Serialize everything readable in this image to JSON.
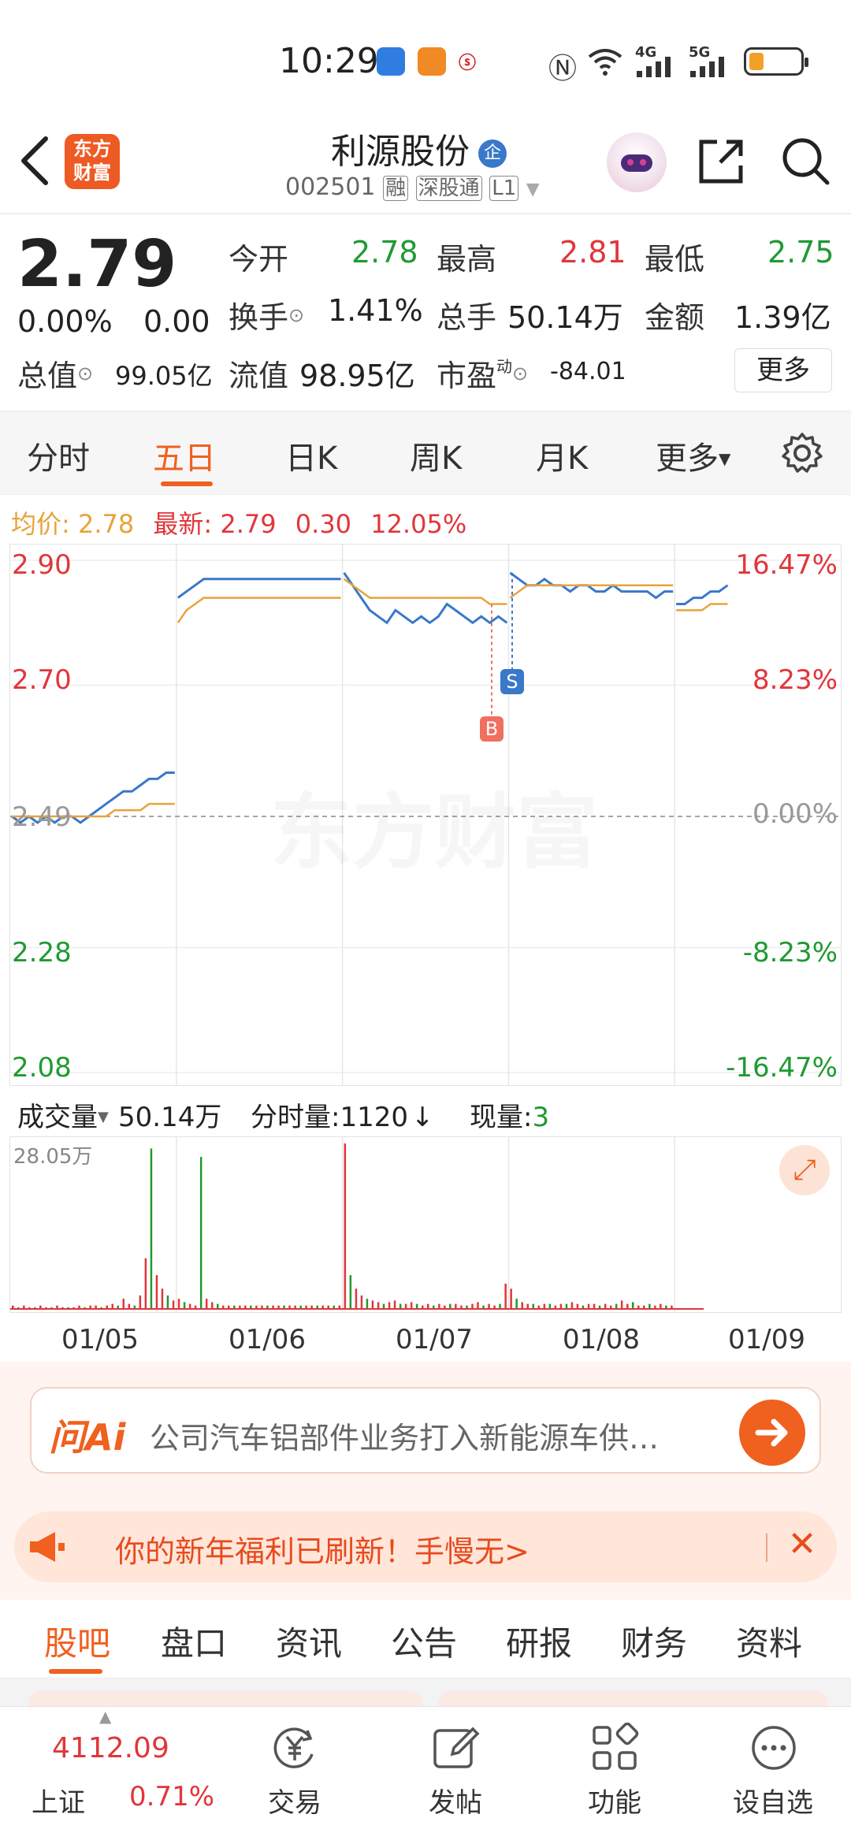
{
  "status_bar": {
    "time": "10:29",
    "network_4g": "4G",
    "network_5g": "5G"
  },
  "header": {
    "logo_text_1": "东方",
    "logo_text_2": "财富",
    "stock_name": "利源股份",
    "badge": "企",
    "code": "002501",
    "tags": [
      "融",
      "深股通",
      "L1"
    ]
  },
  "quote": {
    "price": "2.79",
    "change_pct": "0.00%",
    "change": "0.00",
    "open_label": "今开",
    "open": "2.78",
    "high_label": "最高",
    "high": "2.81",
    "low_label": "最低",
    "low": "2.75",
    "turnover_label": "换手",
    "turnover": "1.41%",
    "volume_label": "总手",
    "volume": "50.14万",
    "amount_label": "金额",
    "amount": "1.39亿",
    "mktcap_label": "总值",
    "mktcap": "99.05亿",
    "float_label": "流值",
    "float": "98.95亿",
    "pe_label": "市盈",
    "pe_sup": "动",
    "pe": "-84.01",
    "more": "更多"
  },
  "tabs": {
    "items": [
      "分时",
      "五日",
      "日K",
      "周K",
      "月K",
      "更多"
    ],
    "active": "五日"
  },
  "avg_line": {
    "avg_label": "均价:",
    "avg": "2.78",
    "last_label": "最新:",
    "last": "2.79",
    "chg": "0.30",
    "pct": "12.05%"
  },
  "chart_data": {
    "type": "line",
    "y_left_ticks": [
      "2.90",
      "2.70",
      "2.49",
      "2.28",
      "2.08"
    ],
    "y_right_ticks": [
      "16.47%",
      "8.23%",
      "0.00%",
      "-8.23%",
      "-16.47%"
    ],
    "ylim": [
      2.08,
      2.9
    ],
    "prev_close": 2.49,
    "x_days": [
      "01/05",
      "01/06",
      "01/07",
      "01/08",
      "01/09"
    ],
    "watermark": "东方财富",
    "markers": [
      {
        "label": "B",
        "day": "01/07"
      },
      {
        "label": "S",
        "day": "01/08"
      }
    ],
    "series": [
      {
        "name": "price",
        "color": "#3a78c9",
        "values": [
          2.49,
          2.48,
          2.49,
          2.48,
          2.49,
          2.48,
          2.49,
          2.49,
          2.48,
          2.49,
          2.5,
          2.51,
          2.52,
          2.53,
          2.53,
          2.54,
          2.55,
          2.55,
          2.56,
          2.56,
          2.84,
          2.85,
          2.86,
          2.87,
          2.87,
          2.87,
          2.87,
          2.87,
          2.87,
          2.87,
          2.87,
          2.87,
          2.87,
          2.87,
          2.87,
          2.87,
          2.87,
          2.87,
          2.87,
          2.87,
          2.88,
          2.86,
          2.84,
          2.82,
          2.81,
          2.8,
          2.82,
          2.81,
          2.8,
          2.81,
          2.8,
          2.81,
          2.83,
          2.82,
          2.81,
          2.8,
          2.81,
          2.8,
          2.81,
          2.8,
          2.88,
          2.87,
          2.86,
          2.86,
          2.87,
          2.86,
          2.86,
          2.85,
          2.86,
          2.86,
          2.85,
          2.85,
          2.86,
          2.85,
          2.85,
          2.85,
          2.85,
          2.84,
          2.85,
          2.85,
          2.83,
          2.83,
          2.84,
          2.84,
          2.85,
          2.85,
          2.86
        ]
      },
      {
        "name": "avg",
        "color": "#e8a33a",
        "values": [
          2.49,
          2.49,
          2.49,
          2.49,
          2.49,
          2.49,
          2.49,
          2.49,
          2.49,
          2.49,
          2.49,
          2.49,
          2.5,
          2.5,
          2.5,
          2.5,
          2.51,
          2.51,
          2.51,
          2.51,
          2.8,
          2.82,
          2.83,
          2.84,
          2.84,
          2.84,
          2.84,
          2.84,
          2.84,
          2.84,
          2.84,
          2.84,
          2.84,
          2.84,
          2.84,
          2.84,
          2.84,
          2.84,
          2.84,
          2.84,
          2.87,
          2.86,
          2.85,
          2.84,
          2.84,
          2.84,
          2.84,
          2.84,
          2.84,
          2.84,
          2.84,
          2.84,
          2.84,
          2.84,
          2.84,
          2.84,
          2.84,
          2.83,
          2.83,
          2.83,
          2.84,
          2.85,
          2.86,
          2.86,
          2.86,
          2.86,
          2.86,
          2.86,
          2.86,
          2.86,
          2.86,
          2.86,
          2.86,
          2.86,
          2.86,
          2.86,
          2.86,
          2.86,
          2.86,
          2.86,
          2.82,
          2.82,
          2.82,
          2.82,
          2.83,
          2.83,
          2.83
        ]
      }
    ]
  },
  "volume": {
    "dropdown_label": "成交量",
    "total": "50.14万",
    "tick_label": "分时量:1120",
    "arrow": "↓",
    "now_label": "现量:",
    "now_value": "3",
    "max_label": "28.05万",
    "bars": [
      2,
      1,
      2,
      1,
      1,
      2,
      1,
      1,
      2,
      1,
      1,
      1,
      2,
      1,
      2,
      2,
      1,
      2,
      3,
      2,
      6,
      3,
      2,
      8,
      30,
      95,
      20,
      12,
      8,
      5,
      6,
      4,
      3,
      2,
      90,
      6,
      4,
      3,
      2,
      2,
      2,
      2,
      2,
      2,
      2,
      2,
      2,
      2,
      2,
      2,
      2,
      2,
      2,
      2,
      2,
      2,
      2,
      2,
      2,
      2,
      98,
      20,
      12,
      8,
      6,
      5,
      4,
      3,
      4,
      5,
      3,
      3,
      4,
      3,
      2,
      3,
      2,
      3,
      2,
      3,
      3,
      2,
      2,
      3,
      4,
      2,
      3,
      2,
      3,
      15,
      12,
      6,
      4,
      3,
      3,
      2,
      3,
      3,
      2,
      3,
      3,
      4,
      3,
      2,
      3,
      3,
      2,
      3,
      2,
      3,
      5,
      3,
      4,
      2,
      2,
      3,
      2,
      3,
      2,
      2
    ]
  },
  "ai": {
    "brand": "问Ai",
    "text": "公司汽车铝部件业务打入新能源车供…"
  },
  "notice": {
    "text": "你的新年福利已刷新！手慢无>"
  },
  "bottom_tabs": {
    "items": [
      "股吧",
      "盘口",
      "资讯",
      "公告",
      "研报",
      "财务",
      "资料"
    ],
    "active": "股吧"
  },
  "bottom_nav": {
    "index_value": "4112.09",
    "index_name": "上证",
    "index_pct": "0.71%",
    "items": [
      "交易",
      "发帖",
      "功能",
      "设自选"
    ]
  },
  "colors": {
    "up": "#e0363b",
    "down": "#1f9a32",
    "accent": "#f0601e",
    "avg": "#e8a33a",
    "line": "#3a78c9"
  }
}
